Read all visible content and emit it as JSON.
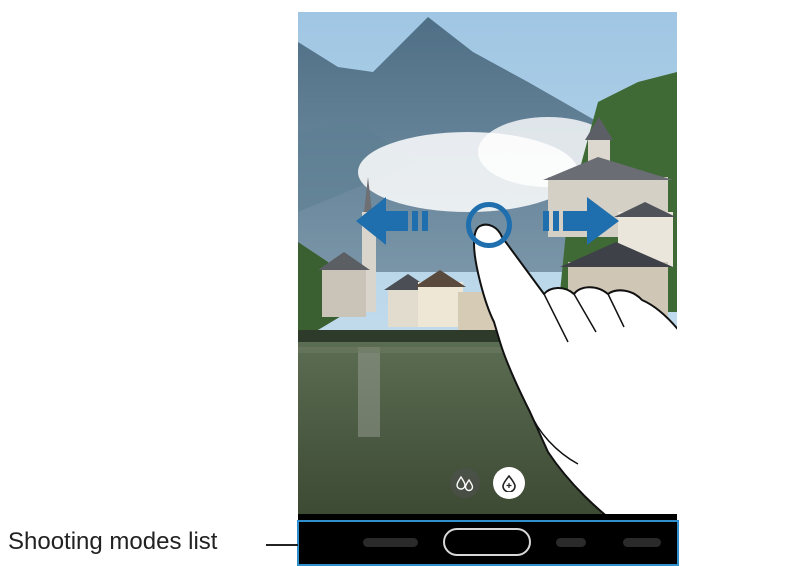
{
  "callout": {
    "label": "Shooting modes list"
  },
  "viewfinder": {
    "scene": "mountain-lake-village-photo",
    "gesture": "swipe-left-right"
  },
  "filters": [
    {
      "icon": "droplets-outline-icon",
      "state": "inactive"
    },
    {
      "icon": "droplet-active-icon",
      "state": "active"
    }
  ],
  "shooting_modes": {
    "items": [
      "",
      "",
      "",
      "",
      ""
    ],
    "selected_index": 2
  },
  "colors": {
    "arrow": "#1f6fae",
    "frame": "#2f8fcd",
    "bar": "#000000"
  }
}
